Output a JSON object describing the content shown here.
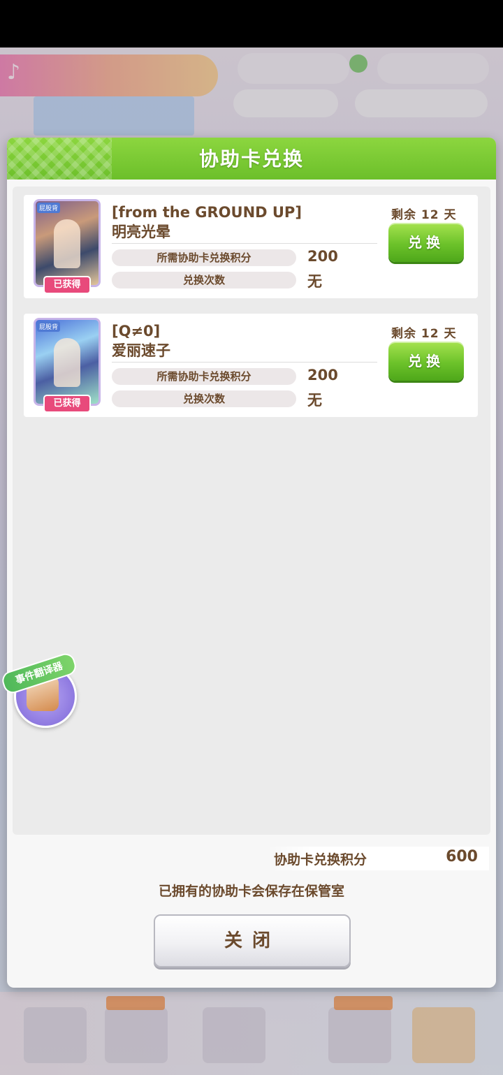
{
  "dialog": {
    "title": "协助卡兑换",
    "items": [
      {
        "thumb_tag": "屁股背",
        "owned_label": "已获得",
        "title": "[from the GROUND UP]",
        "name": "明亮光晕",
        "points_label": "所需协助卡兑换积分",
        "points_value": "200",
        "count_label": "兑换次数",
        "count_value": "无",
        "remaining": "剩余 12 天",
        "button_label": "兑换"
      },
      {
        "thumb_tag": "屁股背",
        "owned_label": "已获得",
        "title": "[Q≠0]",
        "name": "爱丽速子",
        "points_label": "所需协助卡兑换积分",
        "points_value": "200",
        "count_label": "兑换次数",
        "count_value": "无",
        "remaining": "剩余 12 天",
        "button_label": "兑换"
      }
    ],
    "balance_label": "协助卡兑换积分",
    "balance_value": "600",
    "info_text": "已拥有的协助卡会保存在保管室",
    "close_label": "关闭"
  },
  "floating_widget": {
    "label": "事件翻译器"
  },
  "colors": {
    "header_green": "#6cbf2a",
    "button_green": "#6cc22a",
    "text_brown": "#6b4a2d",
    "owned_pink": "#e84a7b"
  }
}
